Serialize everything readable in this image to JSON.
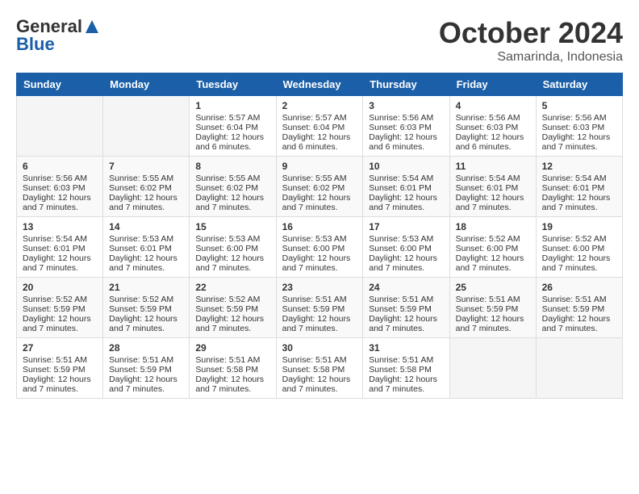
{
  "header": {
    "logo_general": "General",
    "logo_blue": "Blue",
    "title": "October 2024",
    "subtitle": "Samarinda, Indonesia"
  },
  "weekdays": [
    "Sunday",
    "Monday",
    "Tuesday",
    "Wednesday",
    "Thursday",
    "Friday",
    "Saturday"
  ],
  "weeks": [
    [
      {
        "day": "",
        "empty": true
      },
      {
        "day": "",
        "empty": true
      },
      {
        "day": "1",
        "sunrise": "Sunrise: 5:57 AM",
        "sunset": "Sunset: 6:04 PM",
        "daylight": "Daylight: 12 hours and 6 minutes."
      },
      {
        "day": "2",
        "sunrise": "Sunrise: 5:57 AM",
        "sunset": "Sunset: 6:04 PM",
        "daylight": "Daylight: 12 hours and 6 minutes."
      },
      {
        "day": "3",
        "sunrise": "Sunrise: 5:56 AM",
        "sunset": "Sunset: 6:03 PM",
        "daylight": "Daylight: 12 hours and 6 minutes."
      },
      {
        "day": "4",
        "sunrise": "Sunrise: 5:56 AM",
        "sunset": "Sunset: 6:03 PM",
        "daylight": "Daylight: 12 hours and 6 minutes."
      },
      {
        "day": "5",
        "sunrise": "Sunrise: 5:56 AM",
        "sunset": "Sunset: 6:03 PM",
        "daylight": "Daylight: 12 hours and 7 minutes."
      }
    ],
    [
      {
        "day": "6",
        "sunrise": "Sunrise: 5:56 AM",
        "sunset": "Sunset: 6:03 PM",
        "daylight": "Daylight: 12 hours and 7 minutes."
      },
      {
        "day": "7",
        "sunrise": "Sunrise: 5:55 AM",
        "sunset": "Sunset: 6:02 PM",
        "daylight": "Daylight: 12 hours and 7 minutes."
      },
      {
        "day": "8",
        "sunrise": "Sunrise: 5:55 AM",
        "sunset": "Sunset: 6:02 PM",
        "daylight": "Daylight: 12 hours and 7 minutes."
      },
      {
        "day": "9",
        "sunrise": "Sunrise: 5:55 AM",
        "sunset": "Sunset: 6:02 PM",
        "daylight": "Daylight: 12 hours and 7 minutes."
      },
      {
        "day": "10",
        "sunrise": "Sunrise: 5:54 AM",
        "sunset": "Sunset: 6:01 PM",
        "daylight": "Daylight: 12 hours and 7 minutes."
      },
      {
        "day": "11",
        "sunrise": "Sunrise: 5:54 AM",
        "sunset": "Sunset: 6:01 PM",
        "daylight": "Daylight: 12 hours and 7 minutes."
      },
      {
        "day": "12",
        "sunrise": "Sunrise: 5:54 AM",
        "sunset": "Sunset: 6:01 PM",
        "daylight": "Daylight: 12 hours and 7 minutes."
      }
    ],
    [
      {
        "day": "13",
        "sunrise": "Sunrise: 5:54 AM",
        "sunset": "Sunset: 6:01 PM",
        "daylight": "Daylight: 12 hours and 7 minutes."
      },
      {
        "day": "14",
        "sunrise": "Sunrise: 5:53 AM",
        "sunset": "Sunset: 6:01 PM",
        "daylight": "Daylight: 12 hours and 7 minutes."
      },
      {
        "day": "15",
        "sunrise": "Sunrise: 5:53 AM",
        "sunset": "Sunset: 6:00 PM",
        "daylight": "Daylight: 12 hours and 7 minutes."
      },
      {
        "day": "16",
        "sunrise": "Sunrise: 5:53 AM",
        "sunset": "Sunset: 6:00 PM",
        "daylight": "Daylight: 12 hours and 7 minutes."
      },
      {
        "day": "17",
        "sunrise": "Sunrise: 5:53 AM",
        "sunset": "Sunset: 6:00 PM",
        "daylight": "Daylight: 12 hours and 7 minutes."
      },
      {
        "day": "18",
        "sunrise": "Sunrise: 5:52 AM",
        "sunset": "Sunset: 6:00 PM",
        "daylight": "Daylight: 12 hours and 7 minutes."
      },
      {
        "day": "19",
        "sunrise": "Sunrise: 5:52 AM",
        "sunset": "Sunset: 6:00 PM",
        "daylight": "Daylight: 12 hours and 7 minutes."
      }
    ],
    [
      {
        "day": "20",
        "sunrise": "Sunrise: 5:52 AM",
        "sunset": "Sunset: 5:59 PM",
        "daylight": "Daylight: 12 hours and 7 minutes."
      },
      {
        "day": "21",
        "sunrise": "Sunrise: 5:52 AM",
        "sunset": "Sunset: 5:59 PM",
        "daylight": "Daylight: 12 hours and 7 minutes."
      },
      {
        "day": "22",
        "sunrise": "Sunrise: 5:52 AM",
        "sunset": "Sunset: 5:59 PM",
        "daylight": "Daylight: 12 hours and 7 minutes."
      },
      {
        "day": "23",
        "sunrise": "Sunrise: 5:51 AM",
        "sunset": "Sunset: 5:59 PM",
        "daylight": "Daylight: 12 hours and 7 minutes."
      },
      {
        "day": "24",
        "sunrise": "Sunrise: 5:51 AM",
        "sunset": "Sunset: 5:59 PM",
        "daylight": "Daylight: 12 hours and 7 minutes."
      },
      {
        "day": "25",
        "sunrise": "Sunrise: 5:51 AM",
        "sunset": "Sunset: 5:59 PM",
        "daylight": "Daylight: 12 hours and 7 minutes."
      },
      {
        "day": "26",
        "sunrise": "Sunrise: 5:51 AM",
        "sunset": "Sunset: 5:59 PM",
        "daylight": "Daylight: 12 hours and 7 minutes."
      }
    ],
    [
      {
        "day": "27",
        "sunrise": "Sunrise: 5:51 AM",
        "sunset": "Sunset: 5:59 PM",
        "daylight": "Daylight: 12 hours and 7 minutes."
      },
      {
        "day": "28",
        "sunrise": "Sunrise: 5:51 AM",
        "sunset": "Sunset: 5:59 PM",
        "daylight": "Daylight: 12 hours and 7 minutes."
      },
      {
        "day": "29",
        "sunrise": "Sunrise: 5:51 AM",
        "sunset": "Sunset: 5:58 PM",
        "daylight": "Daylight: 12 hours and 7 minutes."
      },
      {
        "day": "30",
        "sunrise": "Sunrise: 5:51 AM",
        "sunset": "Sunset: 5:58 PM",
        "daylight": "Daylight: 12 hours and 7 minutes."
      },
      {
        "day": "31",
        "sunrise": "Sunrise: 5:51 AM",
        "sunset": "Sunset: 5:58 PM",
        "daylight": "Daylight: 12 hours and 7 minutes."
      },
      {
        "day": "",
        "empty": true
      },
      {
        "day": "",
        "empty": true
      }
    ]
  ]
}
